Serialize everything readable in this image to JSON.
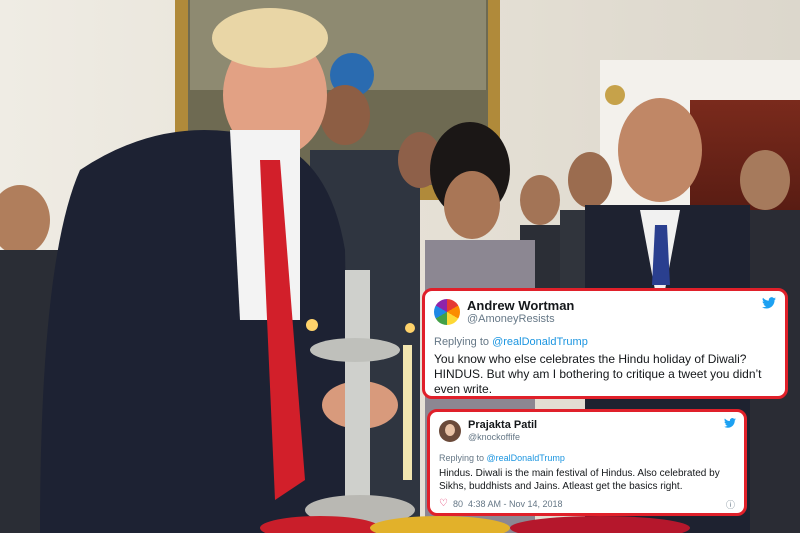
{
  "tweets": [
    {
      "name": "Andrew Wortman",
      "handle": "@AmoneyResists",
      "reply_prefix": "Replying to ",
      "reply_mention": "@realDonaldTrump",
      "text_line1": "You know who else celebrates the Hindu holiday of Diwali?",
      "text_line2": "HINDUS. But why am I bothering to critique a tweet you didn’t",
      "text_line3": "even write."
    },
    {
      "name": "Prajakta Patil",
      "handle": "@knockoffife",
      "reply_prefix": "Replying to ",
      "reply_mention": "@realDonaldTrump",
      "text_line1": "Hindus. Diwali is the main festival of Hindus. Also celebrated by",
      "text_line2": "Sikhs, buddhists and Jains. Atleast get the basics right.",
      "likes": "80",
      "timestamp": "4:38 AM - Nov 14, 2018",
      "info_icon": "info-icon"
    }
  ],
  "colors": {
    "highlight_border": "#e0202a",
    "twitter_blue": "#1da1f2"
  }
}
